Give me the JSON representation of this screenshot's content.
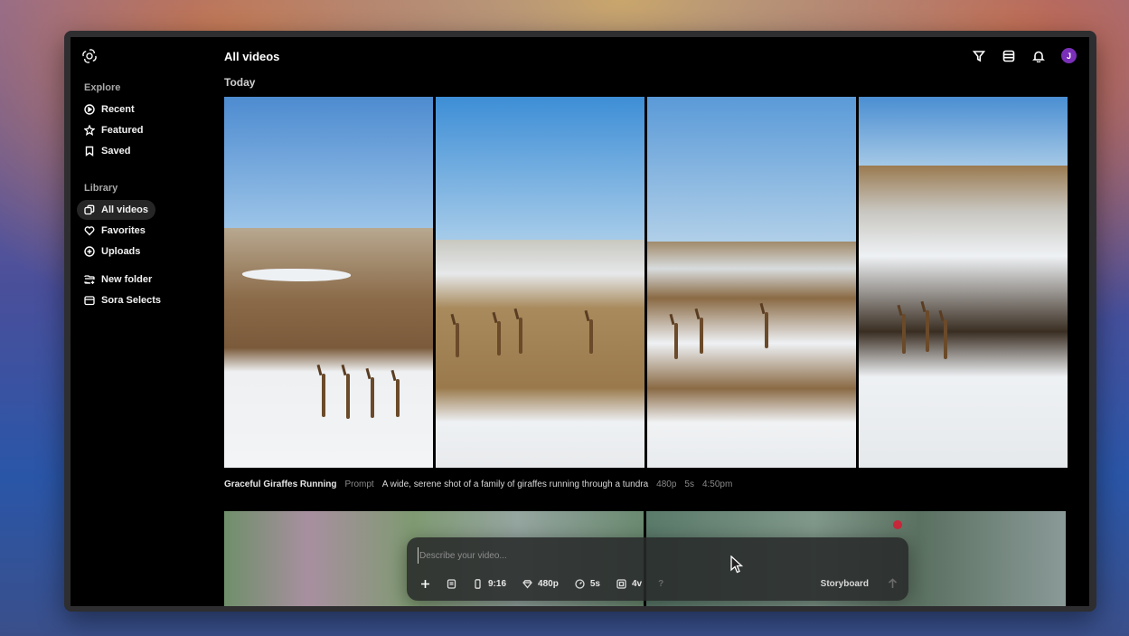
{
  "header": {
    "title": "All videos",
    "icons": [
      "filter-icon",
      "list-view-icon",
      "bell-icon"
    ],
    "avatar_initial": "J",
    "avatar_color": "#7a2fb8"
  },
  "sidebar": {
    "explore_label": "Explore",
    "explore_items": [
      {
        "label": "Recent",
        "icon": "play-circle-icon"
      },
      {
        "label": "Featured",
        "icon": "star-icon"
      },
      {
        "label": "Saved",
        "icon": "bookmark-icon"
      }
    ],
    "library_label": "Library",
    "library_items": [
      {
        "label": "All videos",
        "icon": "videos-icon",
        "active": true
      },
      {
        "label": "Favorites",
        "icon": "heart-icon"
      },
      {
        "label": "Uploads",
        "icon": "upload-circle-icon"
      }
    ],
    "folder_items": [
      {
        "label": "New folder",
        "icon": "new-folder-icon"
      },
      {
        "label": "Sora Selects",
        "icon": "folder-icon"
      }
    ]
  },
  "main": {
    "group_label": "Today",
    "video": {
      "title": "Graceful Giraffes Running",
      "prompt_label": "Prompt",
      "prompt": "A wide, serene shot of a family of giraffes running through a tundra",
      "resolution": "480p",
      "duration": "5s",
      "time": "4:50pm"
    }
  },
  "composer": {
    "placeholder": "Describe your video...",
    "aspect_ratio": "9:16",
    "resolution": "480p",
    "duration": "5s",
    "variations": "4v",
    "help": "?",
    "storyboard_label": "Storyboard"
  }
}
